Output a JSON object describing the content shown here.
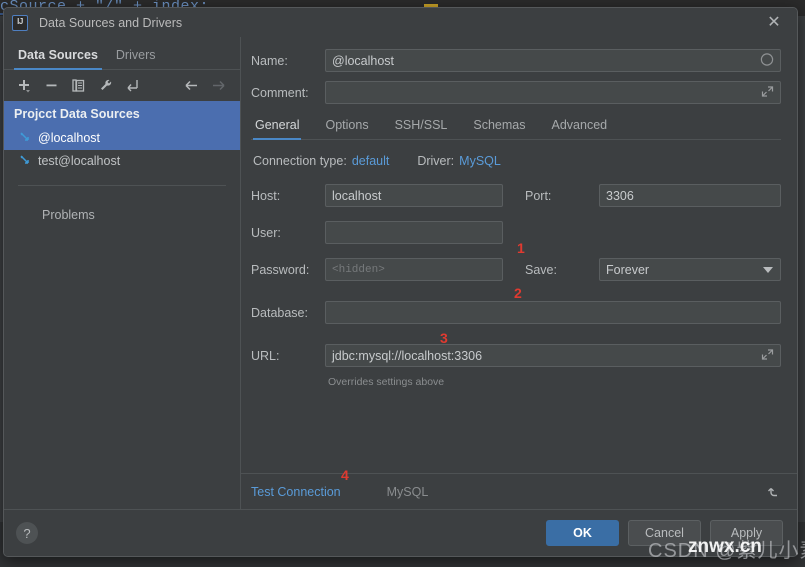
{
  "ide_background": {
    "code_line": "cSource + \"/\" + index;"
  },
  "window": {
    "title": "Data Sources and Drivers",
    "logo_text": "IJ",
    "close_icon": "close-icon"
  },
  "sidebar": {
    "tabs": [
      {
        "label": "Data Sources",
        "active": true
      },
      {
        "label": "Drivers",
        "active": false
      }
    ],
    "toolbar": [
      {
        "name": "add-icon",
        "glyph": "+"
      },
      {
        "name": "remove-icon",
        "glyph": "−"
      },
      {
        "name": "copy-icon",
        "glyph": "❐"
      },
      {
        "name": "wrench-icon",
        "glyph": "ὒ7"
      },
      {
        "name": "import-icon",
        "glyph": "↙"
      },
      {
        "name": "back-arrow-icon",
        "glyph": "←"
      },
      {
        "name": "forward-arrow-icon",
        "glyph": "→"
      }
    ],
    "group_label": "Projcct Data Sources",
    "items": [
      {
        "label": "@localhost",
        "selected": true
      },
      {
        "label": "test@localhost",
        "selected": false
      }
    ],
    "problems_label": "Problems"
  },
  "form": {
    "name_label": "Name:",
    "name_value": "@localhost",
    "comment_label": "Comment:",
    "comment_value": "",
    "tabs": [
      {
        "label": "General",
        "active": true
      },
      {
        "label": "Options",
        "active": false
      },
      {
        "label": "SSH/SSL",
        "active": false
      },
      {
        "label": "Schemas",
        "active": false
      },
      {
        "label": "Advanced",
        "active": false
      }
    ],
    "connection_type_label": "Connection type:",
    "connection_type_value": "default",
    "driver_label": "Driver:",
    "driver_value": "MySQL",
    "host_label": "Host:",
    "host_value": "localhost",
    "port_label": "Port:",
    "port_value": "3306",
    "user_label": "User:",
    "user_value": "",
    "password_label": "Password:",
    "password_placeholder": "<hidden>",
    "save_label": "Save:",
    "save_value": "Forever",
    "database_label": "Database:",
    "database_value": "",
    "url_label": "URL:",
    "url_value": "jdbc:mysql://localhost:3306",
    "url_hint": "Overrides settings above"
  },
  "annotations": {
    "one": "1",
    "two": "2",
    "three": "3",
    "four": "4",
    "color": "#e03a30"
  },
  "test_bar": {
    "test_connection_label": "Test Connection",
    "driver_name": "MySQL",
    "revert_icon": "revert-icon"
  },
  "footer": {
    "help_label": "?",
    "ok_label": "OK",
    "cancel_label": "Cancel",
    "apply_label": "Apply"
  },
  "watermark": {
    "csdn": "CSDN @紫儿小素",
    "site": "znwx.cn"
  },
  "colors": {
    "accent_blue": "#4a88c7",
    "selection_blue": "#4b6eaf",
    "link_blue": "#5a9bd8",
    "panel_bg": "#3c3f41",
    "field_bg": "#45494a",
    "annotation_red": "#e03a30",
    "ok_button": "#3a6ea5"
  }
}
